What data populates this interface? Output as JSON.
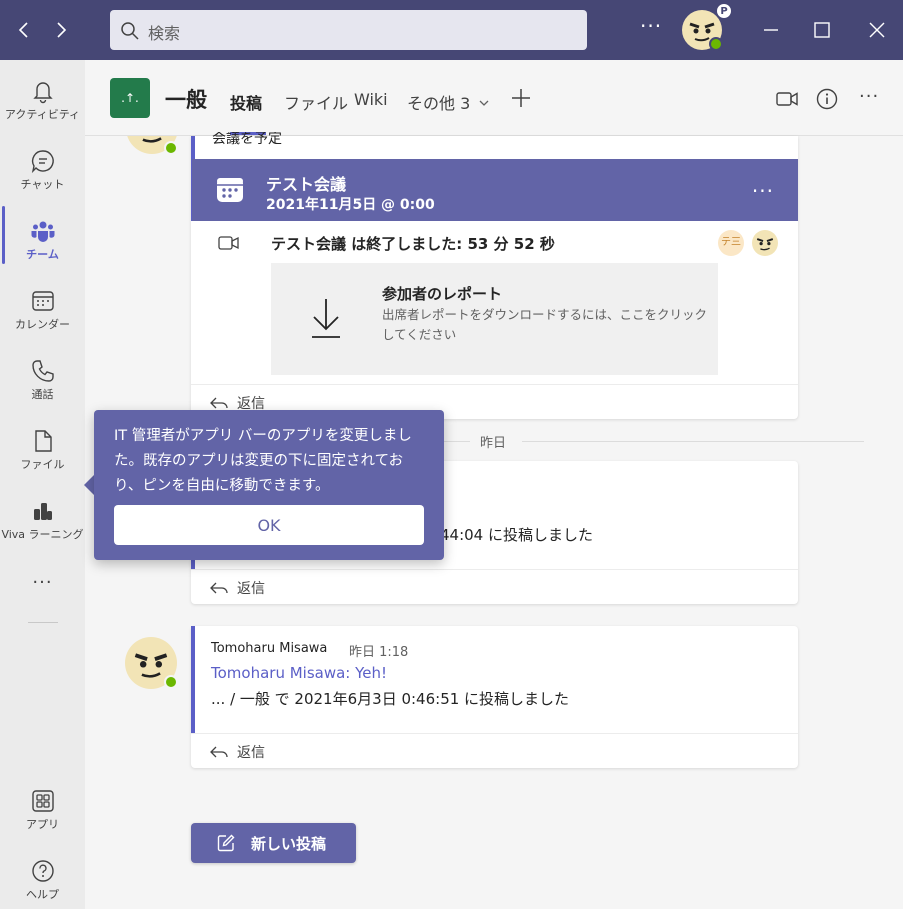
{
  "titlebar": {
    "search_placeholder": "検索",
    "more": "···",
    "badge": "P"
  },
  "rail": {
    "items": [
      {
        "label": "アクティビティ"
      },
      {
        "label": "チャット"
      },
      {
        "label": "チーム"
      },
      {
        "label": "カレンダー"
      },
      {
        "label": "通話"
      },
      {
        "label": "ファイル"
      },
      {
        "label": "Viva ラーニング"
      },
      {
        "label": "アプリ"
      },
      {
        "label": "ヘルプ"
      }
    ],
    "more": "···"
  },
  "channel": {
    "team_icon": ".↑.",
    "name": "一般",
    "tabs": [
      "投稿",
      "ファイル",
      "Wiki",
      "その他 3"
    ],
    "more": "···"
  },
  "meeting_card": {
    "partial_text": "会議を予定",
    "title": "テスト会議",
    "date": "2021年11月5日 @ 0:00",
    "more": "···",
    "ended": "テスト会議 は終了しました: 53 分 52 秒",
    "participant_initials": "テ三",
    "report_title": "参加者のレポート",
    "report_desc": "出席者レポートをダウンロードするには、ここをクリックしてください",
    "reply": "返信"
  },
  "divider": {
    "label": "昨日"
  },
  "post2": {
    "body": "44:04 に投稿しました",
    "reply": "返信"
  },
  "post3": {
    "sender": "Tomoharu Misawa",
    "time": "昨日 1:18",
    "link": "Tomoharu Misawa: Yeh!",
    "body": "... / 一般 で 2021年6月3日 0:46:51 に投稿しました",
    "reply": "返信"
  },
  "new_post": {
    "label": "新しい投稿"
  },
  "bubble": {
    "text": "IT 管理者がアプリ バーのアプリを変更しました。既存のアプリは変更の下に固定されており、ピンを自由に移動できます。",
    "ok": "OK"
  },
  "colors": {
    "titlebar": "#464775",
    "accent": "#6264a7",
    "team_icon": "#237b4b",
    "presence": "#6bb700"
  }
}
